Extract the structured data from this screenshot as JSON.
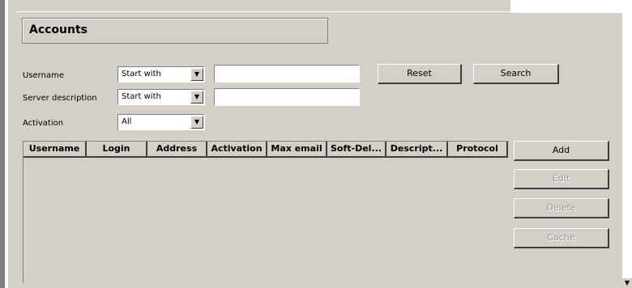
{
  "title": "Accounts",
  "filters": {
    "username": {
      "label": "Username",
      "mode": "Start with",
      "value": ""
    },
    "server_description": {
      "label": "Server description",
      "mode": "Start with",
      "value": ""
    },
    "activation": {
      "label": "Activation",
      "mode": "All"
    }
  },
  "buttons": {
    "reset": "Reset",
    "search": "Search",
    "add": "Add",
    "edit": "Edit",
    "delete": "Delete",
    "cache": "Cache"
  },
  "table": {
    "columns": [
      "Username",
      "Login",
      "Address",
      "Activation",
      "Max email",
      "Soft-Del...",
      "Descript...",
      "Protocol"
    ],
    "rows": []
  },
  "scrollbar": {
    "arrow": "▼"
  }
}
